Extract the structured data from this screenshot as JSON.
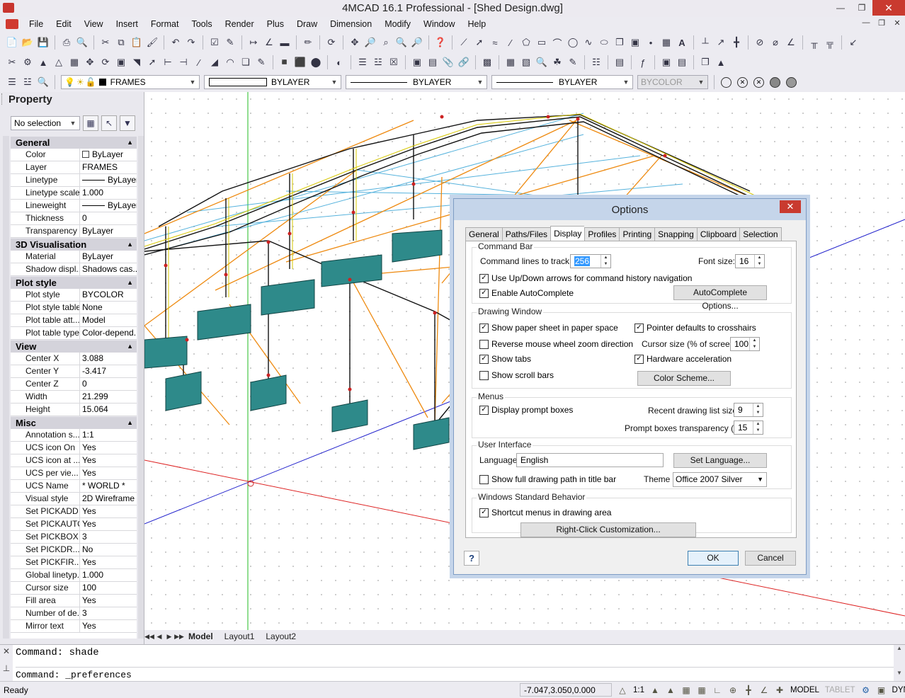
{
  "window": {
    "title": "4MCAD 16.1 Professional - [Shed Design.dwg]"
  },
  "menu": [
    "File",
    "Edit",
    "View",
    "Insert",
    "Format",
    "Tools",
    "Render",
    "Plus",
    "Draw",
    "Dimension",
    "Modify",
    "Window",
    "Help"
  ],
  "layer_bar": {
    "layer": "FRAMES",
    "color": "BYLAYER",
    "linetype": "BYLAYER",
    "lineweight": "BYLAYER",
    "plotstyle": "BYCOLOR"
  },
  "property": {
    "title": "Property",
    "selection": "No selection",
    "sections": [
      {
        "name": "General",
        "rows": [
          {
            "k": "Color",
            "v": "ByLayer"
          },
          {
            "k": "Layer",
            "v": "FRAMES"
          },
          {
            "k": "Linetype",
            "v": "ByLayer"
          },
          {
            "k": "Linetype scale",
            "v": "1.000"
          },
          {
            "k": "Lineweight",
            "v": "ByLayer"
          },
          {
            "k": "Thickness",
            "v": "0"
          },
          {
            "k": "Transparency",
            "v": "ByLayer"
          }
        ]
      },
      {
        "name": "3D Visualisation",
        "rows": [
          {
            "k": "Material",
            "v": "ByLayer"
          },
          {
            "k": "Shadow displ...",
            "v": "Shadows cas..."
          }
        ]
      },
      {
        "name": "Plot style",
        "rows": [
          {
            "k": "Plot style",
            "v": "BYCOLOR"
          },
          {
            "k": "Plot style table",
            "v": "None"
          },
          {
            "k": "Plot table att...",
            "v": "Model"
          },
          {
            "k": "Plot table type",
            "v": "Color-depend..."
          }
        ]
      },
      {
        "name": "View",
        "rows": [
          {
            "k": "Center X",
            "v": "3.088"
          },
          {
            "k": "Center Y",
            "v": "-3.417"
          },
          {
            "k": "Center Z",
            "v": "0"
          },
          {
            "k": "Width",
            "v": "21.299"
          },
          {
            "k": "Height",
            "v": "15.064"
          }
        ]
      },
      {
        "name": "Misc",
        "rows": [
          {
            "k": "Annotation s...",
            "v": "1:1"
          },
          {
            "k": "UCS icon On",
            "v": "Yes"
          },
          {
            "k": "UCS icon at ...",
            "v": "Yes"
          },
          {
            "k": "UCS per vie...",
            "v": "Yes"
          },
          {
            "k": "UCS Name",
            "v": "* WORLD *"
          },
          {
            "k": "Visual style",
            "v": "2D Wireframe"
          },
          {
            "k": "Set PICKADD",
            "v": "Yes"
          },
          {
            "k": "Set PICKAUTO",
            "v": "Yes"
          },
          {
            "k": "Set PICKBOX",
            "v": "3"
          },
          {
            "k": "Set PICKDR...",
            "v": "No"
          },
          {
            "k": "Set PICKFIR...",
            "v": "Yes"
          },
          {
            "k": "Global linetyp...",
            "v": "1.000"
          },
          {
            "k": "Cursor size",
            "v": "100"
          },
          {
            "k": "Fill area",
            "v": "Yes"
          },
          {
            "k": "Number of de...",
            "v": "3"
          },
          {
            "k": "Mirror text",
            "v": "Yes"
          }
        ]
      }
    ]
  },
  "layout_tabs": [
    "Model",
    "Layout1",
    "Layout2"
  ],
  "command": {
    "line1": "Command: shade",
    "line2": "Command: _preferences"
  },
  "status": {
    "ready": "Ready",
    "coords": "-7.047,3.050,0.000",
    "scale": "1:1",
    "model": "MODEL",
    "tablet": "TABLET",
    "dyn": "DYN"
  },
  "dialog": {
    "title": "Options",
    "tabs": [
      "General",
      "Paths/Files",
      "Display",
      "Profiles",
      "Printing",
      "Snapping",
      "Clipboard",
      "Selection"
    ],
    "active_tab": "Display",
    "command_bar": {
      "label": "Command Bar",
      "lines_label": "Command lines to track:",
      "lines_value": "256",
      "font_label": "Font size:",
      "font_value": "16",
      "updown": "Use Up/Down arrows for command history navigation",
      "autocomplete": "Enable AutoComplete",
      "autocomplete_btn": "AutoComplete Options..."
    },
    "drawing_window": {
      "label": "Drawing Window",
      "paper": "Show paper sheet in paper space",
      "crosshairs": "Pointer defaults to crosshairs",
      "reverse": "Reverse mouse wheel zoom direction",
      "cursor_label": "Cursor size (% of screen):",
      "cursor_value": "100",
      "tabs": "Show tabs",
      "hw": "Hardware acceleration",
      "scroll": "Show scroll bars",
      "scheme_btn": "Color Scheme..."
    },
    "menus": {
      "label": "Menus",
      "prompt": "Display prompt boxes",
      "recent_label": "Recent drawing list size:",
      "recent_value": "9",
      "transp_label": "Prompt boxes transparency (%):",
      "transp_value": "15"
    },
    "ui": {
      "label": "User Interface",
      "lang_label": "Language",
      "lang_value": "English",
      "set_lang_btn": "Set Language...",
      "fullpath": "Show full drawing path in title bar",
      "theme_label": "Theme",
      "theme_value": "Office 2007 Silver"
    },
    "wsb": {
      "label": "Windows Standard Behavior",
      "shortcut": "Shortcut menus in drawing area",
      "rightclick_btn": "Right-Click Customization..."
    },
    "ok": "OK",
    "cancel": "Cancel",
    "help": "?"
  }
}
